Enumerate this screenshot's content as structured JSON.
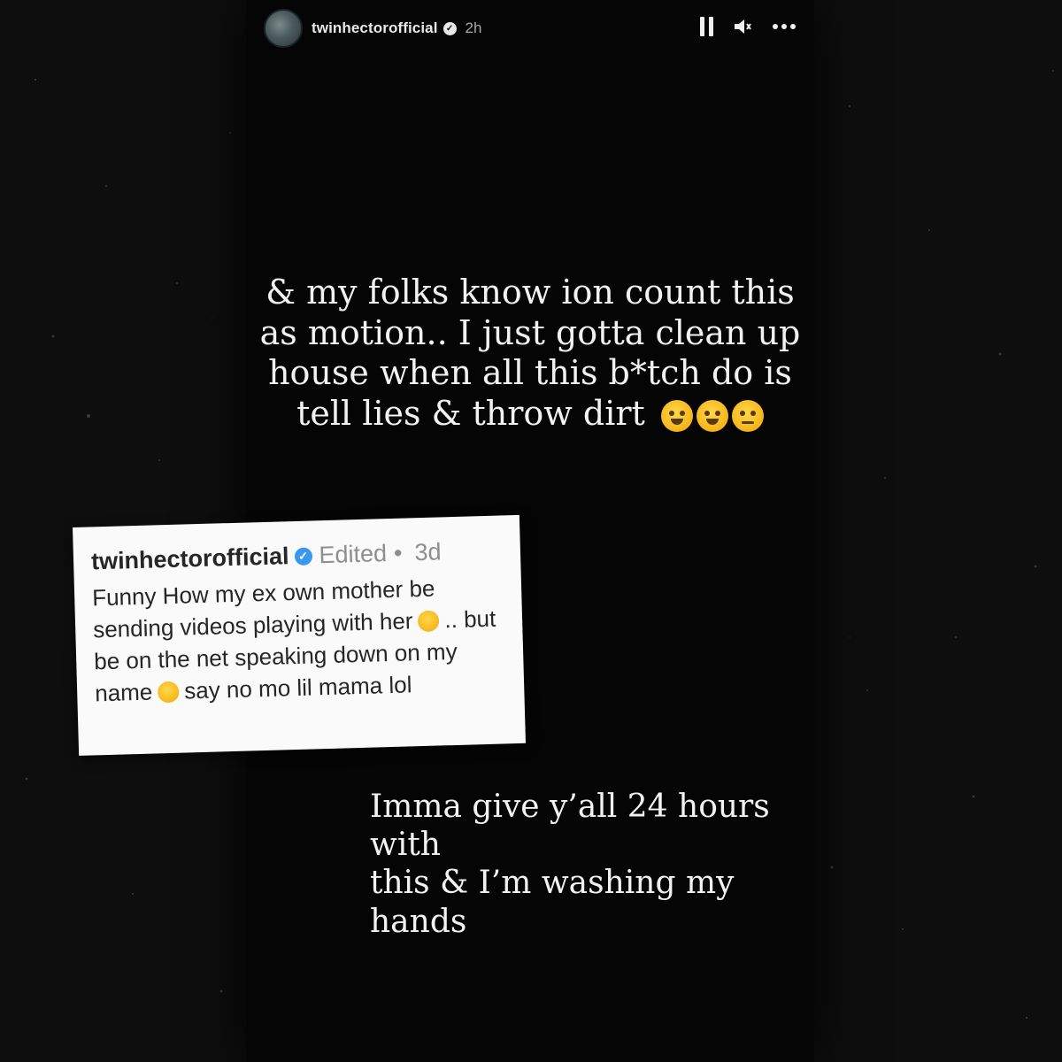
{
  "story": {
    "username": "twinhectorofficial",
    "time": "2h",
    "icons": {
      "avatar": "avatar",
      "verified": "verified-badge-icon",
      "pause": "pause-icon",
      "sound": "speaker-icon",
      "more": "more-options-icon"
    },
    "text_1_line_1": "& my folks know ion count this",
    "text_1_line_2": "as motion.. I just gotta clean up",
    "text_1_line_3": "house when all this b*tch do is",
    "text_1_line_4": "tell lies & throw dirt",
    "text_1_emojis": [
      "laughing-crying-emoji",
      "weary-face-emoji",
      "disappointed-face-emoji"
    ],
    "text_2_line_1": "Imma give y’all 24 hours with",
    "text_2_line_2": "this & I’m washing my hands"
  },
  "post": {
    "username": "twinhectorofficial",
    "edited": "Edited",
    "separator": "•",
    "time": "3d",
    "body_line_1": "Funny How my ex own mother be",
    "body_line_2a": "sending videos playing with her",
    "body_line_2b": ".. but",
    "body_line_3": "be on the net speaking down on my",
    "body_line_4a": "name",
    "body_line_4b": "say no mo lil mama lol",
    "emojis": [
      "cat-face-emoji",
      "astonished-face-emoji"
    ]
  },
  "colors": {
    "background": "#0e0e0e",
    "story_background": "#050505",
    "story_text": "#f2f2f2",
    "card_background": "#fafafa",
    "verified_blue": "#3897f0"
  }
}
